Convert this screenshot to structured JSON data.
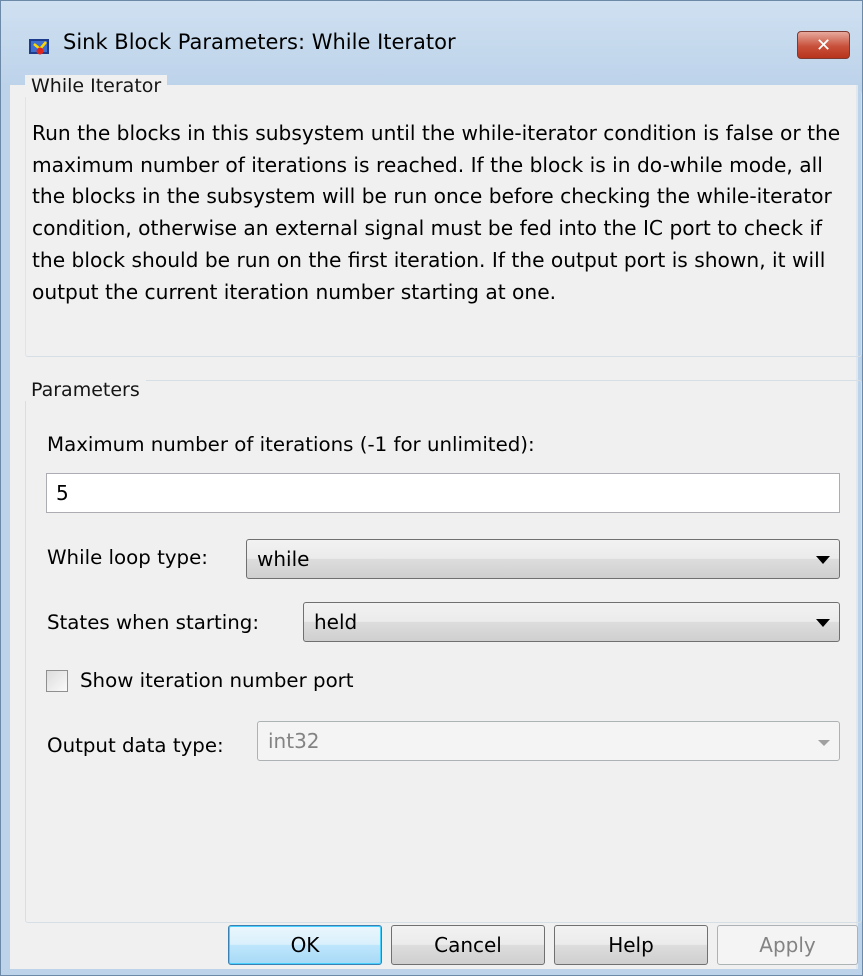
{
  "window": {
    "title": "Sink Block Parameters: While Iterator",
    "close_glyph": "✕"
  },
  "description": {
    "group_title": "While Iterator",
    "text": "Run the blocks in this subsystem until the while-iterator condition is false or the maximum number of iterations is reached.  If the block is in do-while mode, all the blocks in the subsystem will be run once before checking the while-iterator condition, otherwise an external signal must be fed into the IC port to check if the block should be run on the first iteration. If the output port is shown, it will output the current iteration number starting at one."
  },
  "parameters": {
    "group_title": "Parameters",
    "max_iterations": {
      "label": "Maximum number of iterations (-1 for unlimited):",
      "value": "5"
    },
    "loop_type": {
      "label": "While loop type:",
      "value": "while"
    },
    "states": {
      "label": "States when starting:",
      "value": "held"
    },
    "show_port": {
      "label": "Show iteration number port",
      "checked": false
    },
    "output_type": {
      "label": "Output data type:",
      "value": "int32",
      "enabled": false
    }
  },
  "buttons": {
    "ok": "OK",
    "cancel": "Cancel",
    "help": "Help",
    "apply": "Apply"
  },
  "icons": {
    "app": "simulink-block-icon",
    "close": "close-icon",
    "dropdown": "chevron-down-icon"
  },
  "colors": {
    "titlebar": "#bcd3ea",
    "close_button": "#c8503b",
    "dialog_bg": "#f0f0f0"
  }
}
